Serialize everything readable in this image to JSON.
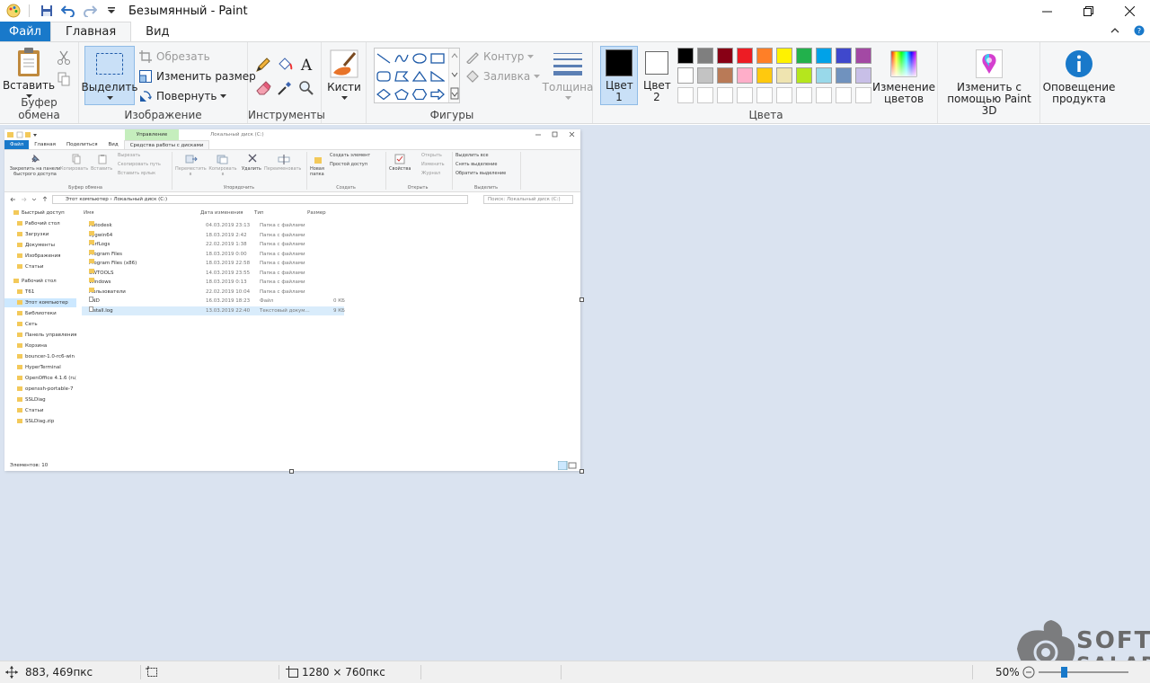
{
  "window": {
    "title": "Безымянный - Paint"
  },
  "tabs": {
    "file": "Файл",
    "home": "Главная",
    "view": "Вид"
  },
  "ribbon": {
    "clipboard": {
      "label": "Буфер обмена",
      "paste": "Вставить"
    },
    "image": {
      "label": "Изображение",
      "select": "Выделить",
      "crop": "Обрезать",
      "resize": "Изменить размер",
      "rotate": "Повернуть"
    },
    "tools": {
      "label": "Инструменты",
      "brushes": "Кисти"
    },
    "shapes": {
      "label": "Фигуры",
      "outline": "Контур",
      "fill": "Заливка",
      "thickness": "Толщина"
    },
    "colors": {
      "label": "Цвета",
      "color1": "Цвет 1",
      "color2": "Цвет 2",
      "edit_colors": "Изменение цветов",
      "paint3d": "Изменить с помощью Paint 3D",
      "product_alert": "Оповещение продукта",
      "color1_value": "#000000",
      "color2_value": "#ffffff",
      "palette_row1": [
        "#000000",
        "#7f7f7f",
        "#880015",
        "#ed1c24",
        "#ff7f27",
        "#fff200",
        "#22b14c",
        "#00a2e8",
        "#3f48cc",
        "#a349a4"
      ],
      "palette_row2": [
        "#ffffff",
        "#c3c3c3",
        "#b97a57",
        "#ffaec9",
        "#ffc90e",
        "#efe4b0",
        "#b5e61d",
        "#99d9ea",
        "#7092be",
        "#c8bfe7"
      ]
    }
  },
  "explorer": {
    "tab_manage": "Управление",
    "title": "Локальный диск (C:)",
    "tabs": [
      "Файл",
      "Главная",
      "Поделиться",
      "Вид",
      "Средства работы с дисками"
    ],
    "ribbon": {
      "pin": "Закрепить на панели быстрого доступа",
      "copy": "Копировать",
      "paste": "Вставить",
      "cut": "Вырезать",
      "copy_path": "Скопировать путь",
      "paste_shortcut": "Вставить ярлык",
      "clipboard_group": "Буфер обмена",
      "move_to": "Переместить в",
      "copy_to": "Копировать в",
      "delete": "Удалить",
      "rename": "Переименовать",
      "organize_group": "Упорядочить",
      "new_folder": "Новая папка",
      "new_item": "Создать элемент",
      "easy_access": "Простой доступ",
      "create_group": "Создать",
      "properties": "Свойства",
      "open": "Открыть",
      "edit": "Изменить",
      "history": "Журнал",
      "open_group": "Открыть",
      "select_all": "Выделить все",
      "select_none": "Снять выделение",
      "invert": "Обратить выделение",
      "select_group": "Выделить"
    },
    "address": {
      "crumb1": "Этот компьютер",
      "crumb2": "Локальный диск (C:)",
      "search_placeholder": "Поиск: Локальный диск (C:)"
    },
    "nav": [
      "Быстрый доступ",
      "Рабочий стол",
      "Загрузки",
      "Документы",
      "Изображения",
      "Статьи",
      "Рабочий стол",
      "Т61",
      "Этот компьютер",
      "Библиотеки",
      "Сеть",
      "Панель управления",
      "Корзина",
      "bouncer-1.0-rc6-win",
      "HyperTerminal",
      "OpenOffice 4.1.6 (ru)",
      "openssh-portable-7",
      "SSLDiag",
      "Статьи",
      "SSLDiag.zip"
    ],
    "columns": {
      "name": "Имя",
      "date": "Дата изменения",
      "type": "Тип",
      "size": "Размер"
    },
    "rows": [
      {
        "name": "Autodesk",
        "date": "04.03.2019 23:13",
        "type": "Папка с файлами",
        "size": ""
      },
      {
        "name": "cygwin64",
        "date": "18.03.2019 2:42",
        "type": "Папка с файлами",
        "size": ""
      },
      {
        "name": "PerfLogs",
        "date": "22.02.2019 1:38",
        "type": "Папка с файлами",
        "size": ""
      },
      {
        "name": "Program Files",
        "date": "18.03.2019 0:00",
        "type": "Папка с файлами",
        "size": ""
      },
      {
        "name": "Program Files (x86)",
        "date": "18.03.2019 22:58",
        "type": "Папка с файлами",
        "size": ""
      },
      {
        "name": "SWTOOLS",
        "date": "14.03.2019 23:55",
        "type": "Папка с файлами",
        "size": ""
      },
      {
        "name": "Windows",
        "date": "18.03.2019 0:13",
        "type": "Папка с файлами",
        "size": ""
      },
      {
        "name": "Пользователи",
        "date": "22.02.2019 10:04",
        "type": "Папка с файлами",
        "size": ""
      },
      {
        "name": "END",
        "date": "16.03.2019 18:23",
        "type": "Файл",
        "size": "0 КБ"
      },
      {
        "name": "install.log",
        "date": "13.03.2019 22:40",
        "type": "Текстовый докум...",
        "size": "9 КБ"
      }
    ],
    "status": "Элементов: 10"
  },
  "statusbar": {
    "cursor_pos": "883, 469пкс",
    "selection_size": "",
    "canvas_size": "1280 × 760пкс",
    "zoom": "50%"
  },
  "watermark": {
    "line1": "SOFT",
    "line2": "SALAD"
  }
}
